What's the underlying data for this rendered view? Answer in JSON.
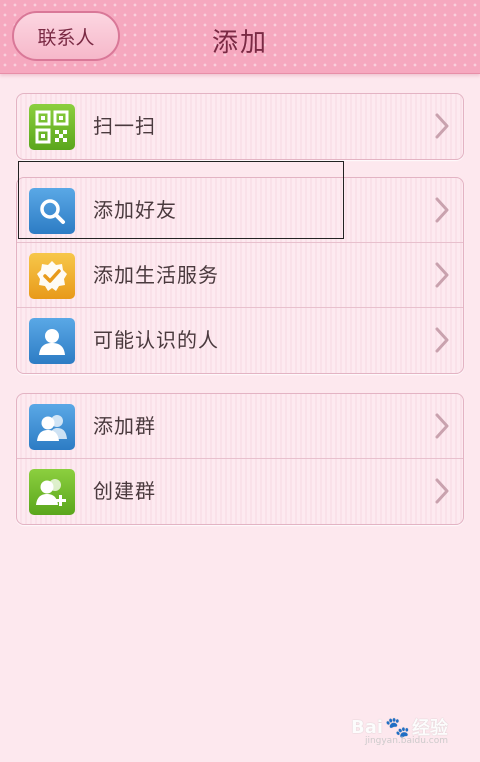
{
  "header": {
    "back_label": "联系人",
    "title": "添加"
  },
  "groups": [
    {
      "items": [
        {
          "label": "扫一扫",
          "icon": "qr-code-icon",
          "icon_color": "#6cb82a"
        }
      ]
    },
    {
      "items": [
        {
          "label": "添加好友",
          "icon": "search-icon",
          "icon_color": "#3b8fd6"
        },
        {
          "label": "添加生活服务",
          "icon": "verified-badge-icon",
          "icon_color": "#f0b030"
        },
        {
          "label": "可能认识的人",
          "icon": "person-icon",
          "icon_color": "#3b8fd6"
        }
      ]
    },
    {
      "items": [
        {
          "label": "添加群",
          "icon": "group-icon",
          "icon_color": "#3b8fd6"
        },
        {
          "label": "创建群",
          "icon": "create-group-icon",
          "icon_color": "#6cb82a"
        }
      ]
    }
  ],
  "watermark": {
    "brand": "Bai",
    "brand2": "经验",
    "url": "jingyan.baidu.com"
  },
  "colors": {
    "header_bg": "#f6a8bf",
    "page_bg": "#fde8ee",
    "text": "#4a3a3e"
  }
}
